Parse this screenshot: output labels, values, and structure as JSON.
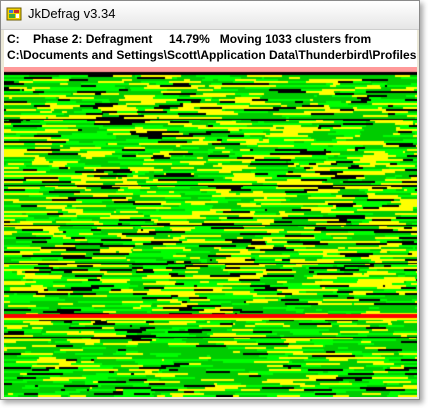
{
  "window": {
    "title": "JkDefrag v3.34",
    "icon": "jkdefrag-app-icon"
  },
  "status": {
    "line1": "C:    Phase 2: Defragment     14.79%   Moving 1033 clusters from",
    "line2": "C:\\Documents and Settings\\Scott\\Application Data\\Thunderbird\\Profiles"
  },
  "disk_map": {
    "legend_colors": {
      "free_space": "#000000",
      "fragmented": "#ffff00",
      "unfragmented": "#00cc00",
      "busy": "#00ff00",
      "mft_reserved": "#ff9999",
      "system": "#ff0000"
    }
  }
}
